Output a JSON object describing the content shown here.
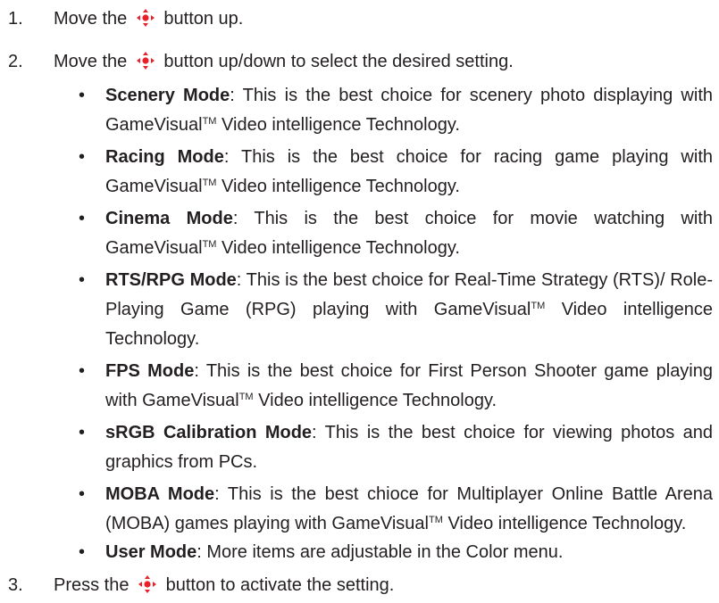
{
  "steps": [
    {
      "number": "1.",
      "before": "Move the",
      "after": "button up."
    },
    {
      "number": "2.",
      "before": "Move the",
      "after": "button up/down to select the desired setting."
    },
    {
      "number": "3.",
      "before": "Press the",
      "after": "button to activate the setting."
    }
  ],
  "bullet_char": "•",
  "trademark": "TM",
  "modes": [
    {
      "name": "Scenery Mode",
      "text1": ": This is the best choice for scenery photo displaying with GameVisual",
      "text2": " Video intelligence Technology."
    },
    {
      "name": "Racing Mode",
      "text1": ": This is the best choice for racing game playing with GameVisual",
      "text2": " Video intelligence Technology."
    },
    {
      "name": "Cinema Mode",
      "text1": ": This is the best choice for movie watching with GameVisual",
      "text2": " Video intelligence Technology."
    },
    {
      "name": "RTS/RPG Mode",
      "text1": ": This is the best choice for Real-Time Strategy (RTS)/ Role-Playing Game (RPG) playing with GameVisual",
      "text2": " Video intelligence Technology."
    },
    {
      "name": "FPS Mode",
      "text1": ": This is the best choice for First Person Shooter game playing with GameVisual",
      "text2": " Video intelligence Technology."
    },
    {
      "name": "sRGB Calibration Mode",
      "text1": ": This is the best choice for viewing photos and graphics from PCs."
    },
    {
      "name": "MOBA Mode",
      "text1": ": This is the best chioce for Multiplayer Online Battle Arena (MOBA) games playing with GameVisual",
      "text2": " Video intelligence Technology."
    },
    {
      "name": "User Mode",
      "text1": ": More items are adjustable in the Color menu."
    }
  ],
  "icon": {
    "name": "navigation-joystick",
    "color": "#e8202a"
  }
}
